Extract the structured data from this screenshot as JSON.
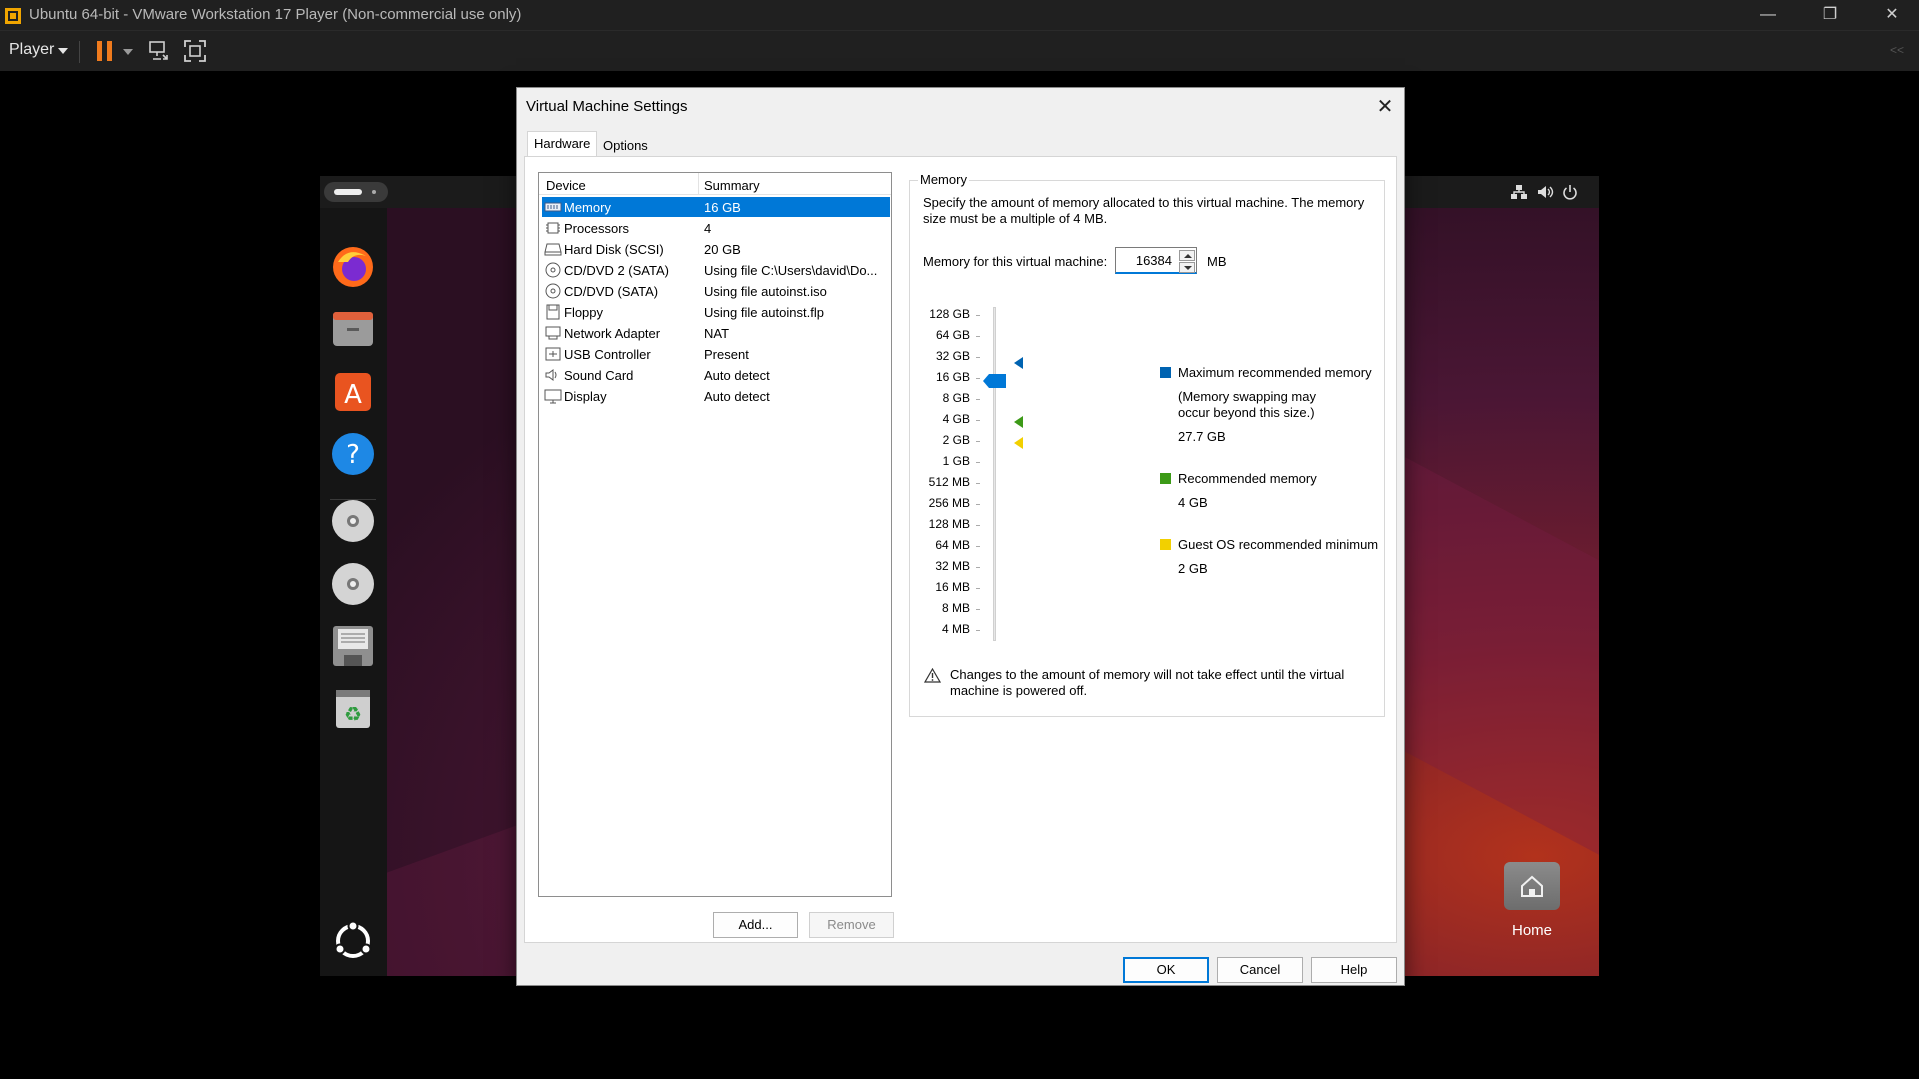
{
  "window": {
    "title": "Ubuntu 64-bit - VMware Workstation 17 Player (Non-commercial use only)",
    "minimize_icon": "minimize-icon",
    "maximize_icon": "restore-icon",
    "close_icon": "close-icon"
  },
  "toolbar": {
    "player_label": "Player",
    "collapse_label": "<<"
  },
  "guest": {
    "home_label": "Home",
    "dock": [
      "firefox-icon",
      "files-icon",
      "app-center-icon",
      "help-icon",
      "cd-drive-icon",
      "cd-drive-icon",
      "floppy-icon",
      "trash-icon",
      "show-apps-icon"
    ]
  },
  "dialog": {
    "title": "Virtual Machine Settings",
    "tabs": [
      {
        "label": "Hardware",
        "active": true
      },
      {
        "label": "Options",
        "active": false
      }
    ],
    "device_list": {
      "headers": {
        "device": "Device",
        "summary": "Summary"
      },
      "rows": [
        {
          "device": "Memory",
          "summary": "16 GB",
          "icon": "memory-icon",
          "selected": true
        },
        {
          "device": "Processors",
          "summary": "4",
          "icon": "processor-icon"
        },
        {
          "device": "Hard Disk (SCSI)",
          "summary": "20 GB",
          "icon": "hard-disk-icon"
        },
        {
          "device": "CD/DVD 2 (SATA)",
          "summary": "Using file C:\\Users\\david\\Do...",
          "icon": "cd-dvd-icon"
        },
        {
          "device": "CD/DVD (SATA)",
          "summary": "Using file autoinst.iso",
          "icon": "cd-dvd-icon"
        },
        {
          "device": "Floppy",
          "summary": "Using file autoinst.flp",
          "icon": "floppy-icon"
        },
        {
          "device": "Network Adapter",
          "summary": "NAT",
          "icon": "network-adapter-icon"
        },
        {
          "device": "USB Controller",
          "summary": "Present",
          "icon": "usb-icon"
        },
        {
          "device": "Sound Card",
          "summary": "Auto detect",
          "icon": "sound-card-icon"
        },
        {
          "device": "Display",
          "summary": "Auto detect",
          "icon": "display-icon"
        }
      ]
    },
    "add_button": "Add...",
    "remove_button": "Remove",
    "memory": {
      "group_title": "Memory",
      "description": "Specify the amount of memory allocated to this virtual machine. The memory size must be a multiple of 4 MB.",
      "field_label": "Memory for this virtual machine:",
      "value": "16384",
      "unit": "MB",
      "scale": [
        "128 GB",
        "64 GB",
        "32 GB",
        "16 GB",
        "8 GB",
        "4 GB",
        "2 GB",
        "1 GB",
        "512 MB",
        "256 MB",
        "128 MB",
        "64 MB",
        "32 MB",
        "16 MB",
        "8 MB",
        "4 MB"
      ],
      "slider_value": "16 GB",
      "legend": {
        "max": {
          "label": "Maximum recommended memory",
          "note": "(Memory swapping may occur beyond this size.)",
          "value": "27.7 GB",
          "color": "#0063b1"
        },
        "recommended": {
          "label": "Recommended memory",
          "value": "4 GB",
          "color": "#3c9a17"
        },
        "minimum": {
          "label": "Guest OS recommended minimum",
          "value": "2 GB",
          "color": "#f2d000"
        }
      },
      "warning": "Changes to the amount of memory will not take effect until the virtual machine is powered off."
    },
    "ok_button": "OK",
    "cancel_button": "Cancel",
    "help_button": "Help"
  }
}
